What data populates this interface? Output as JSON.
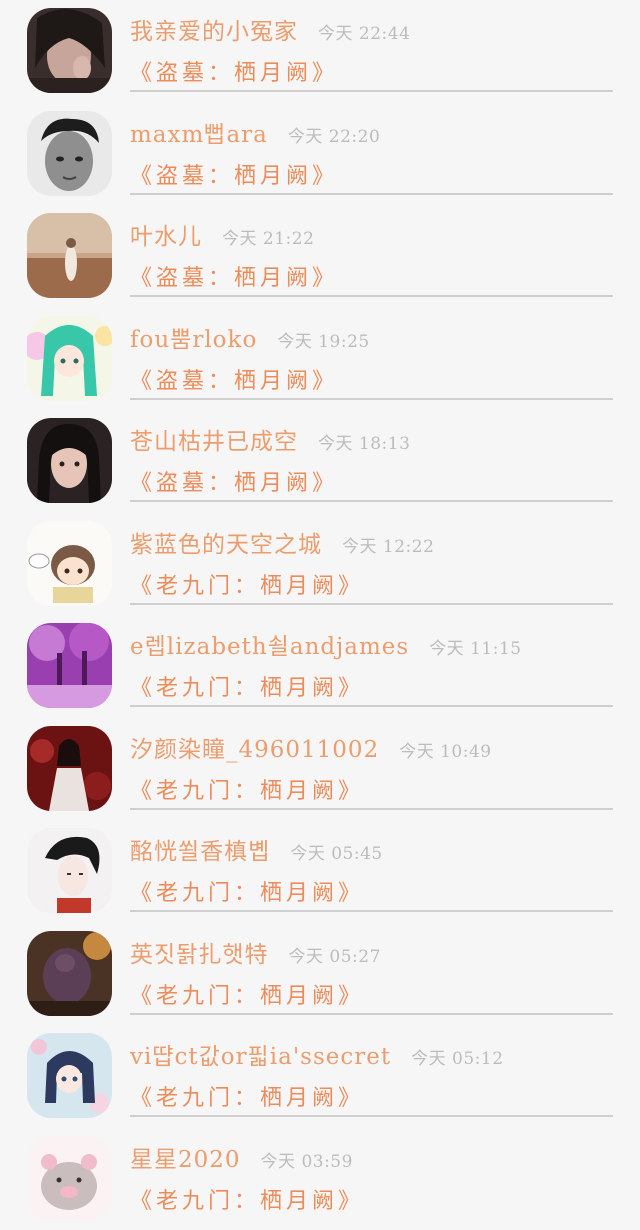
{
  "comments": [
    {
      "name": "我亲爱的小冤家",
      "time": "今天 22:44",
      "quote": "《盗墓：栖月阙》"
    },
    {
      "name": "maxm뻡ara",
      "time": "今天 22:20",
      "quote": "《盗墓：栖月阙》"
    },
    {
      "name": "叶水儿",
      "time": "今天 21:22",
      "quote": "《盗墓：栖月阙》"
    },
    {
      "name": "fou뿜rloko",
      "time": "今天 19:25",
      "quote": "《盗墓：栖月阙》"
    },
    {
      "name": "苍山枯井已成空",
      "time": "今天 18:13",
      "quote": "《盗墓：栖月阙》"
    },
    {
      "name": "紫蓝色的天空之城",
      "time": "今天 12:22",
      "quote": "《老九门：栖月阙》"
    },
    {
      "name": "e렙lizabeth쇨andjames",
      "time": "今天 11:15",
      "quote": "《老九门：栖月阙》"
    },
    {
      "name": "汐颜染瞳_496011002",
      "time": "今天 10:49",
      "quote": "《老九门：栖月阙》"
    },
    {
      "name": "酩恍쐴香槙볩",
      "time": "今天 05:45",
      "quote": "《老九门：栖月阙》"
    },
    {
      "name": "英짓돩扎햇特",
      "time": "今天 05:27",
      "quote": "《老九门：栖月阙》"
    },
    {
      "name": "vi땹ct값or핇ia'ssecret",
      "time": "今天 05:12",
      "quote": "《老九门：栖月阙》"
    },
    {
      "name": "星星2020",
      "time": "今天 03:59",
      "quote": "《老九门：栖月阙》"
    }
  ]
}
